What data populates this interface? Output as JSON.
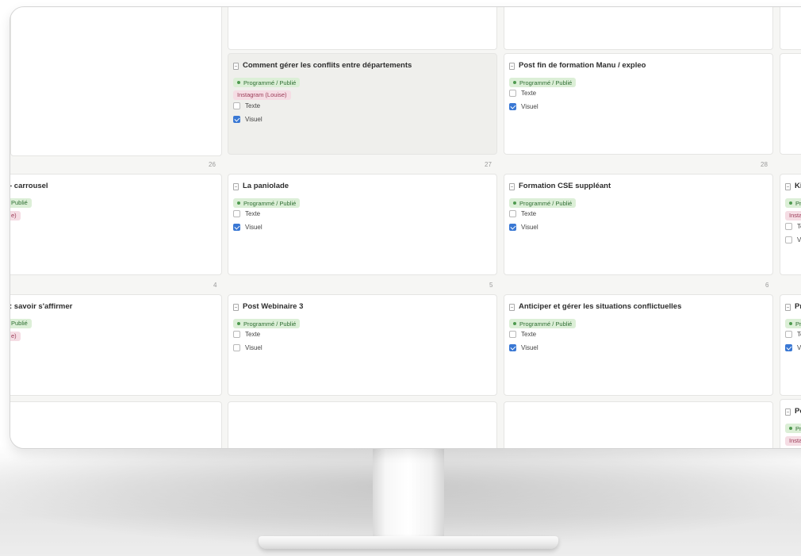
{
  "labels": {
    "texte": "Texte",
    "visuel": "Visuel"
  },
  "day_numbers": [
    "26",
    "27",
    "28",
    "4",
    "5",
    "6"
  ],
  "cards": [
    {
      "title": "Comment gérer les conflits entre départements",
      "status": "Programmé / Publié",
      "channel": "Instagram (Louise)",
      "texte": false,
      "visuel": true,
      "selected": true
    },
    {
      "title": "Post fin de formation Manu / expleo",
      "status": "Programmé / Publié",
      "channel": "",
      "texte": false,
      "visuel": true
    },
    {
      "title": "- carrousel",
      "status": "Publié",
      "channel": "e)",
      "clipped": true
    },
    {
      "title": "La paniolade",
      "status": "Programmé / Publié",
      "channel": "",
      "texte": false,
      "visuel": true
    },
    {
      "title": "Formation CSE suppléant",
      "status": "Programmé / Publié",
      "channel": "",
      "texte": false,
      "visuel": true
    },
    {
      "title": "Ki",
      "status": "Pr",
      "channel": "Insta",
      "texte_label": "Te",
      "visuel_label": "Vi",
      "texte": false,
      "visuel": false,
      "clipped": true
    },
    {
      "title": ": savoir s'affirmer",
      "status": "Publié",
      "channel": "e)",
      "clipped": true
    },
    {
      "title": "Post Webinaire 3",
      "status": "Programmé / Publié",
      "channel": "",
      "texte": false,
      "visuel": false
    },
    {
      "title": "Anticiper et gérer les situations conflictuelles",
      "status": "Programmé / Publié",
      "channel": "",
      "texte": false,
      "visuel": true
    },
    {
      "title": "Pr",
      "status": "Pr",
      "channel": "",
      "texte_label": "Te",
      "visuel_label": "Vi",
      "texte": false,
      "visuel": true,
      "clipped": true
    },
    {
      "title": "Po",
      "status": "Pr",
      "channel": "Insta",
      "clipped": true
    }
  ]
}
